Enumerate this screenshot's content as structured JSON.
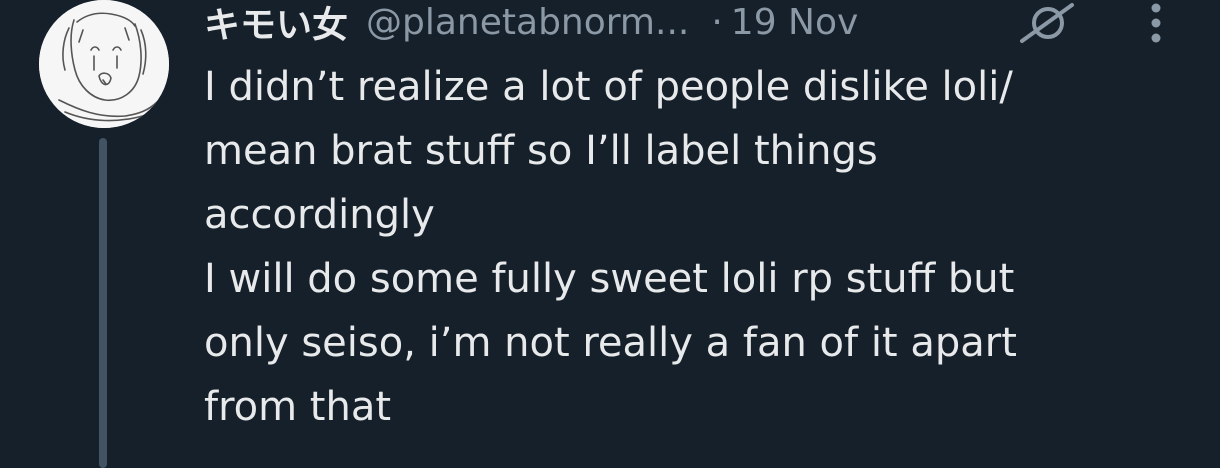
{
  "tweet": {
    "display_name": "キモい女",
    "handle": "@planetabnorm...",
    "separator": "·",
    "date": "19 Nov",
    "lines": [
      "I didn’t realize a lot of people dislike loli/",
      "mean brat stuff so I’ll label things",
      "accordingly",
      "I will do some fully sweet loli rp stuff but",
      "only seiso, i’m not really a fan of it apart",
      "from that"
    ]
  },
  "icons": {
    "avatar": "avatar-sketch",
    "grok": "grok-icon",
    "more": "more-options-icon"
  },
  "colors": {
    "background": "#15202b",
    "text": "#e7e9ea",
    "secondary": "#8b98a5",
    "thread_line": "#425364"
  }
}
